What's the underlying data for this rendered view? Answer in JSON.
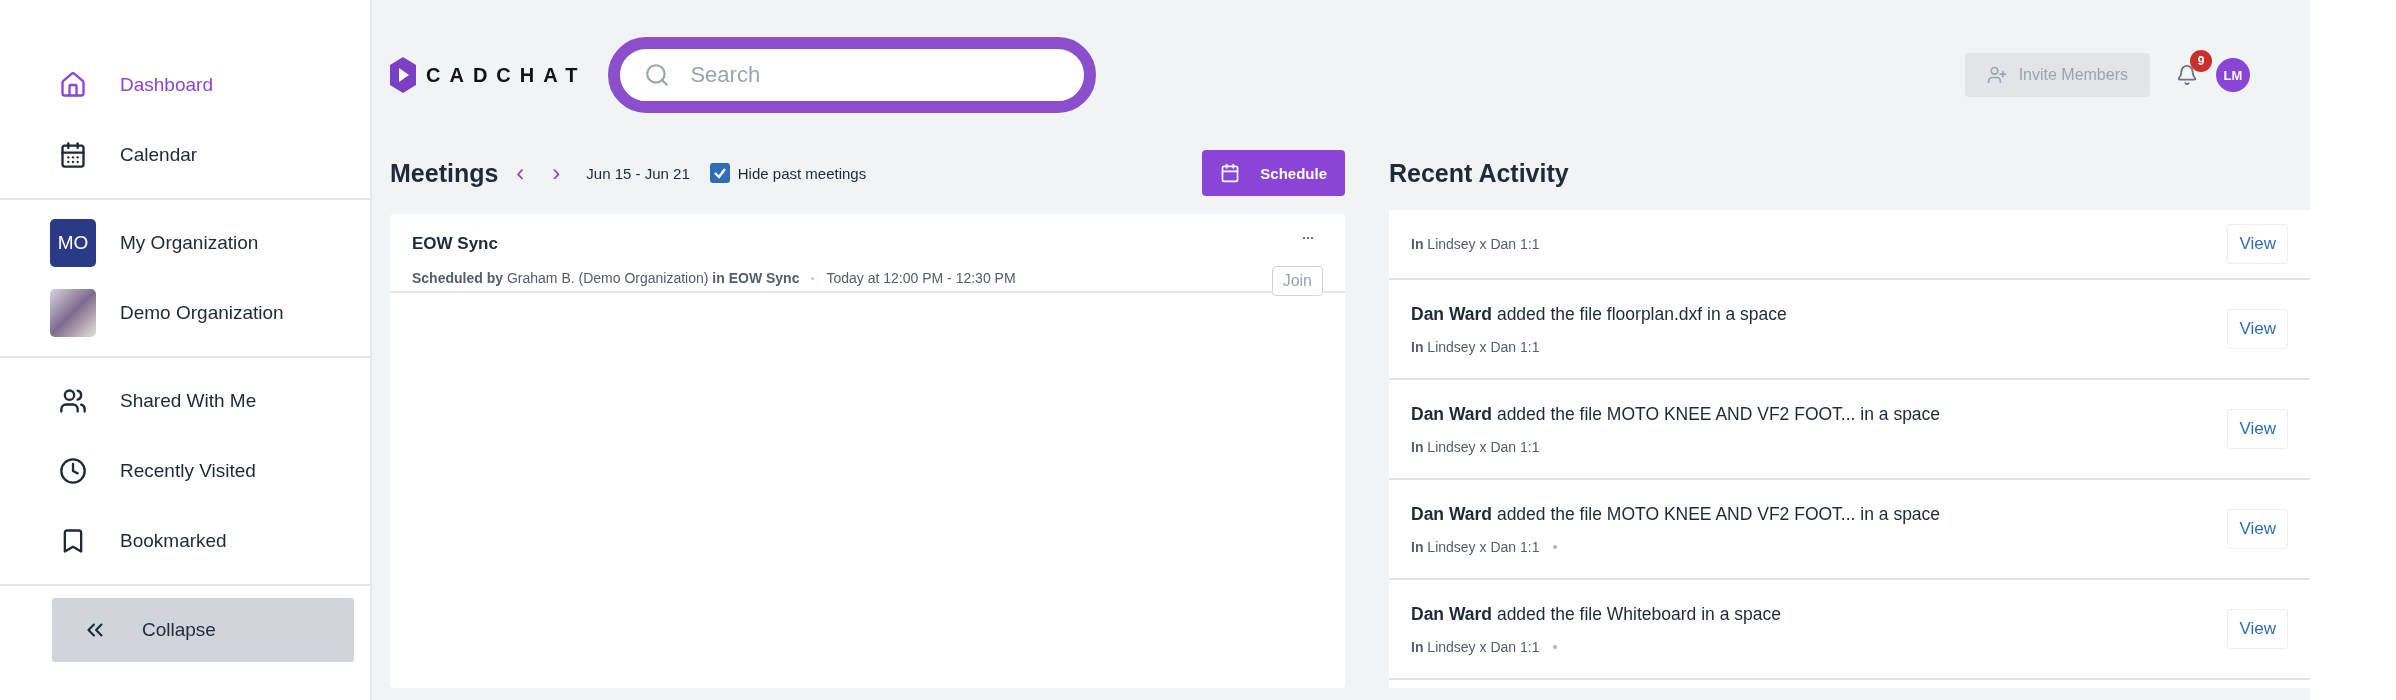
{
  "sidebar": {
    "groups": [
      [
        {
          "label": "Dashboard",
          "kind": "icon",
          "selected": true
        },
        {
          "label": "Calendar",
          "kind": "icon",
          "selected": false
        }
      ],
      [
        {
          "label": "My Organization",
          "kind": "initials",
          "initials": "MO",
          "selected": false
        },
        {
          "label": "Demo Organization",
          "kind": "photo",
          "selected": false
        }
      ],
      [
        {
          "label": "Shared With Me",
          "kind": "icon",
          "selected": false
        },
        {
          "label": "Recently Visited",
          "kind": "icon",
          "selected": false
        },
        {
          "label": "Bookmarked",
          "kind": "icon",
          "selected": false
        }
      ]
    ],
    "collapse": "Collapse"
  },
  "header": {
    "logo": "CADCHAT",
    "search": {
      "placeholder": "Search"
    },
    "invite": {
      "label": "Invite Members",
      "disabled": true
    },
    "notifications": "9",
    "avatar": "LM"
  },
  "meetings": {
    "title": "Meetings",
    "prev": "‹",
    "next": "›",
    "range": "Jun 15 - Jun 21",
    "hide_past": {
      "label": "Hide past meetings",
      "checked": true
    },
    "schedule": "Schedule",
    "items": [
      {
        "title": "EOW Sync",
        "by": "**Scheduled by** Graham B. (Demo Organization) **in EOW Sync**",
        "time": "Today at 12:00 PM - 12:30 PM",
        "join": "Join",
        "more": "···"
      }
    ]
  },
  "activity": {
    "title": "Recent Activity",
    "items": [
      {
        "meta": "**In** Lindsey x Dan 1:1",
        "dot": false,
        "action": "View"
      },
      {
        "text": "**Dan Ward** added the file floorplan.dxf in a space",
        "meta": "**In** Lindsey x Dan 1:1",
        "dot": false,
        "action": "View"
      },
      {
        "text": "**Dan Ward** added the file MOTO KNEE AND VF2 FOOT... in a space",
        "meta": "**In** Lindsey x Dan 1:1",
        "dot": false,
        "action": "View"
      },
      {
        "text": "**Dan Ward** added the file MOTO KNEE AND VF2 FOOT... in a space",
        "meta": "**In** Lindsey x Dan 1:1",
        "dot": true,
        "action": "View"
      },
      {
        "text": "**Dan Ward** added the file Whiteboard in a space",
        "meta": "**In** Lindsey x Dan 1:1",
        "dot": true,
        "action": "View"
      }
    ]
  }
}
